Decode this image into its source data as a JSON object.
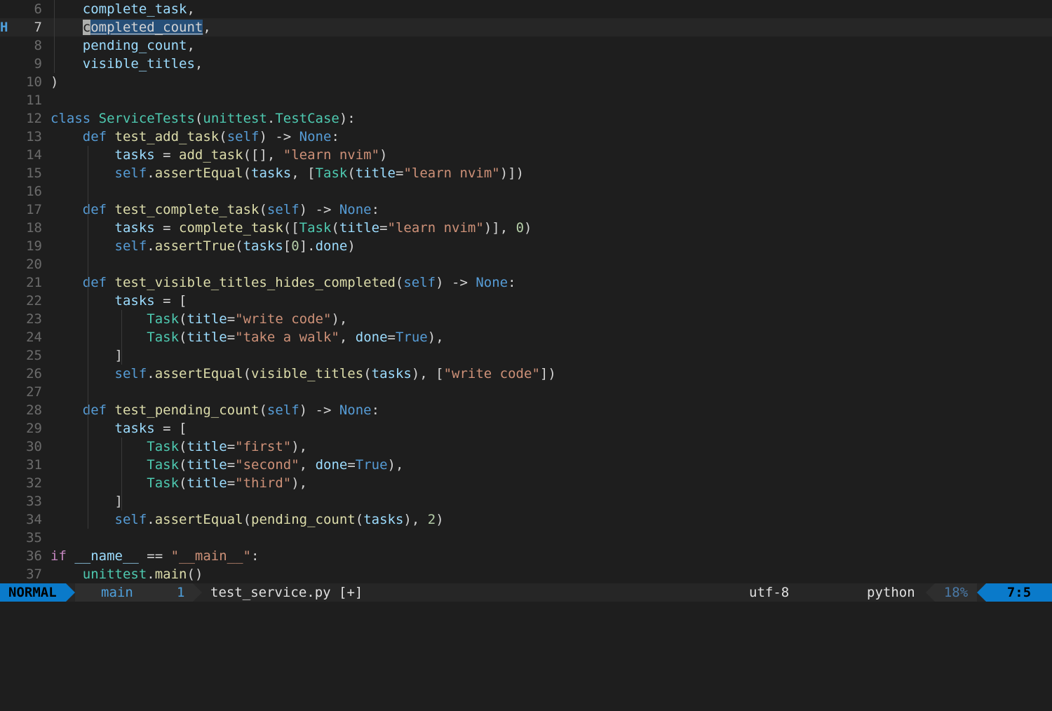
{
  "editor": {
    "lines": [
      {
        "n": "6",
        "tokens": [
          [
            "    ",
            "p"
          ],
          [
            "complete_task",
            "var"
          ],
          [
            ",",
            "p"
          ]
        ]
      },
      {
        "n": "7",
        "sign": "H",
        "current": true,
        "tokens": [
          [
            "    ",
            "p"
          ],
          [
            "c",
            "cursor"
          ],
          [
            "ompleted_count",
            "hl"
          ],
          [
            ",",
            "p"
          ]
        ]
      },
      {
        "n": "8",
        "tokens": [
          [
            "    ",
            "p"
          ],
          [
            "pending_count",
            "var"
          ],
          [
            ",",
            "p"
          ]
        ]
      },
      {
        "n": "9",
        "tokens": [
          [
            "    ",
            "p"
          ],
          [
            "visible_titles",
            "var"
          ],
          [
            ",",
            "p"
          ]
        ]
      },
      {
        "n": "10",
        "tokens": [
          [
            ")",
            "p"
          ]
        ]
      },
      {
        "n": "11",
        "tokens": []
      },
      {
        "n": "12",
        "tokens": [
          [
            "class ",
            "kw"
          ],
          [
            "ServiceTests",
            "cls"
          ],
          [
            "(",
            "p"
          ],
          [
            "unittest",
            "cls"
          ],
          [
            ".",
            "p"
          ],
          [
            "TestCase",
            "cls"
          ],
          [
            "):",
            "p"
          ]
        ]
      },
      {
        "n": "13",
        "tokens": [
          [
            "    ",
            "p"
          ],
          [
            "def ",
            "kw"
          ],
          [
            "test_add_task",
            "fn"
          ],
          [
            "(",
            "p"
          ],
          [
            "self",
            "self"
          ],
          [
            ") -> ",
            "p"
          ],
          [
            "None",
            "kw"
          ],
          [
            ":",
            "p"
          ]
        ]
      },
      {
        "n": "14",
        "tokens": [
          [
            "        ",
            "p"
          ],
          [
            "tasks",
            "var"
          ],
          [
            " = ",
            "p"
          ],
          [
            "add_task",
            "fn"
          ],
          [
            "([], ",
            "p"
          ],
          [
            "\"learn nvim\"",
            "str"
          ],
          [
            ")",
            "p"
          ]
        ]
      },
      {
        "n": "15",
        "tokens": [
          [
            "        ",
            "p"
          ],
          [
            "self",
            "self"
          ],
          [
            ".",
            "p"
          ],
          [
            "assertEqual",
            "fn"
          ],
          [
            "(",
            "p"
          ],
          [
            "tasks",
            "var"
          ],
          [
            ", [",
            "p"
          ],
          [
            "Task",
            "cls"
          ],
          [
            "(",
            "p"
          ],
          [
            "title",
            "var"
          ],
          [
            "=",
            "p"
          ],
          [
            "\"learn nvim\"",
            "str"
          ],
          [
            ")])",
            "p"
          ]
        ]
      },
      {
        "n": "16",
        "tokens": []
      },
      {
        "n": "17",
        "tokens": [
          [
            "    ",
            "p"
          ],
          [
            "def ",
            "kw"
          ],
          [
            "test_complete_task",
            "fn"
          ],
          [
            "(",
            "p"
          ],
          [
            "self",
            "self"
          ],
          [
            ") -> ",
            "p"
          ],
          [
            "None",
            "kw"
          ],
          [
            ":",
            "p"
          ]
        ]
      },
      {
        "n": "18",
        "tokens": [
          [
            "        ",
            "p"
          ],
          [
            "tasks",
            "var"
          ],
          [
            " = ",
            "p"
          ],
          [
            "complete_task",
            "fn"
          ],
          [
            "([",
            "p"
          ],
          [
            "Task",
            "cls"
          ],
          [
            "(",
            "p"
          ],
          [
            "title",
            "var"
          ],
          [
            "=",
            "p"
          ],
          [
            "\"learn nvim\"",
            "str"
          ],
          [
            ")], ",
            "p"
          ],
          [
            "0",
            "num"
          ],
          [
            ")",
            "p"
          ]
        ]
      },
      {
        "n": "19",
        "tokens": [
          [
            "        ",
            "p"
          ],
          [
            "self",
            "self"
          ],
          [
            ".",
            "p"
          ],
          [
            "assertTrue",
            "fn"
          ],
          [
            "(",
            "p"
          ],
          [
            "tasks",
            "var"
          ],
          [
            "[",
            "p"
          ],
          [
            "0",
            "num"
          ],
          [
            "].",
            "p"
          ],
          [
            "done",
            "var"
          ],
          [
            ")",
            "p"
          ]
        ]
      },
      {
        "n": "20",
        "tokens": []
      },
      {
        "n": "21",
        "tokens": [
          [
            "    ",
            "p"
          ],
          [
            "def ",
            "kw"
          ],
          [
            "test_visible_titles_hides_completed",
            "fn"
          ],
          [
            "(",
            "p"
          ],
          [
            "self",
            "self"
          ],
          [
            ") -> ",
            "p"
          ],
          [
            "None",
            "kw"
          ],
          [
            ":",
            "p"
          ]
        ]
      },
      {
        "n": "22",
        "tokens": [
          [
            "        ",
            "p"
          ],
          [
            "tasks",
            "var"
          ],
          [
            " = [",
            "p"
          ]
        ]
      },
      {
        "n": "23",
        "tokens": [
          [
            "            ",
            "p"
          ],
          [
            "Task",
            "cls"
          ],
          [
            "(",
            "p"
          ],
          [
            "title",
            "var"
          ],
          [
            "=",
            "p"
          ],
          [
            "\"write code\"",
            "str"
          ],
          [
            "),",
            "p"
          ]
        ]
      },
      {
        "n": "24",
        "tokens": [
          [
            "            ",
            "p"
          ],
          [
            "Task",
            "cls"
          ],
          [
            "(",
            "p"
          ],
          [
            "title",
            "var"
          ],
          [
            "=",
            "p"
          ],
          [
            "\"take a walk\"",
            "str"
          ],
          [
            ", ",
            "p"
          ],
          [
            "done",
            "var"
          ],
          [
            "=",
            "p"
          ],
          [
            "True",
            "kw"
          ],
          [
            "),",
            "p"
          ]
        ]
      },
      {
        "n": "25",
        "tokens": [
          [
            "        ",
            "p"
          ],
          [
            "]",
            "p"
          ]
        ]
      },
      {
        "n": "26",
        "tokens": [
          [
            "        ",
            "p"
          ],
          [
            "self",
            "self"
          ],
          [
            ".",
            "p"
          ],
          [
            "assertEqual",
            "fn"
          ],
          [
            "(",
            "p"
          ],
          [
            "visible_titles",
            "fn"
          ],
          [
            "(",
            "p"
          ],
          [
            "tasks",
            "var"
          ],
          [
            "), [",
            "p"
          ],
          [
            "\"write code\"",
            "str"
          ],
          [
            "])",
            "p"
          ]
        ]
      },
      {
        "n": "27",
        "tokens": []
      },
      {
        "n": "28",
        "tokens": [
          [
            "    ",
            "p"
          ],
          [
            "def ",
            "kw"
          ],
          [
            "test_pending_count",
            "fn"
          ],
          [
            "(",
            "p"
          ],
          [
            "self",
            "self"
          ],
          [
            ") -> ",
            "p"
          ],
          [
            "None",
            "kw"
          ],
          [
            ":",
            "p"
          ]
        ]
      },
      {
        "n": "29",
        "tokens": [
          [
            "        ",
            "p"
          ],
          [
            "tasks",
            "var"
          ],
          [
            " = [",
            "p"
          ]
        ]
      },
      {
        "n": "30",
        "tokens": [
          [
            "            ",
            "p"
          ],
          [
            "Task",
            "cls"
          ],
          [
            "(",
            "p"
          ],
          [
            "title",
            "var"
          ],
          [
            "=",
            "p"
          ],
          [
            "\"first\"",
            "str"
          ],
          [
            "),",
            "p"
          ]
        ]
      },
      {
        "n": "31",
        "tokens": [
          [
            "            ",
            "p"
          ],
          [
            "Task",
            "cls"
          ],
          [
            "(",
            "p"
          ],
          [
            "title",
            "var"
          ],
          [
            "=",
            "p"
          ],
          [
            "\"second\"",
            "str"
          ],
          [
            ", ",
            "p"
          ],
          [
            "done",
            "var"
          ],
          [
            "=",
            "p"
          ],
          [
            "True",
            "kw"
          ],
          [
            "),",
            "p"
          ]
        ]
      },
      {
        "n": "32",
        "tokens": [
          [
            "            ",
            "p"
          ],
          [
            "Task",
            "cls"
          ],
          [
            "(",
            "p"
          ],
          [
            "title",
            "var"
          ],
          [
            "=",
            "p"
          ],
          [
            "\"third\"",
            "str"
          ],
          [
            "),",
            "p"
          ]
        ]
      },
      {
        "n": "33",
        "tokens": [
          [
            "        ",
            "p"
          ],
          [
            "]",
            "p"
          ]
        ]
      },
      {
        "n": "34",
        "tokens": [
          [
            "        ",
            "p"
          ],
          [
            "self",
            "self"
          ],
          [
            ".",
            "p"
          ],
          [
            "assertEqual",
            "fn"
          ],
          [
            "(",
            "p"
          ],
          [
            "pending_count",
            "fn"
          ],
          [
            "(",
            "p"
          ],
          [
            "tasks",
            "var"
          ],
          [
            "), ",
            "p"
          ],
          [
            "2",
            "num"
          ],
          [
            ")",
            "p"
          ]
        ]
      },
      {
        "n": "35",
        "tokens": []
      },
      {
        "n": "36",
        "tokens": [
          [
            "if ",
            "ctl"
          ],
          [
            "__name__",
            "var"
          ],
          [
            " == ",
            "p"
          ],
          [
            "\"__main__\"",
            "str"
          ],
          [
            ":",
            "p"
          ]
        ]
      },
      {
        "n": "37",
        "tokens": [
          [
            "    ",
            "p"
          ],
          [
            "unittest",
            "cls"
          ],
          [
            ".",
            "p"
          ],
          [
            "main",
            "fn"
          ],
          [
            "()",
            "p"
          ]
        ]
      }
    ]
  },
  "statusline": {
    "mode": "NORMAL",
    "branch_icon": "git-branch-icon",
    "branch": "main",
    "diagnostic_icon": "lightbulb-icon",
    "diagnostic_count": "1",
    "filename": "test_service.py",
    "modified": "[+]",
    "encoding": "utf-8",
    "os_icon": "linux-icon",
    "filetype_icon": "python-icon",
    "filetype": "python",
    "percent": "18%",
    "position": "7:5"
  },
  "colors": {
    "background": "#1e1e1e",
    "accent": "#0a7aca",
    "keyword": "#569cd6",
    "string": "#ce9178",
    "class": "#4ec9b0",
    "function": "#dcdcaa",
    "variable": "#9cdcfe"
  }
}
